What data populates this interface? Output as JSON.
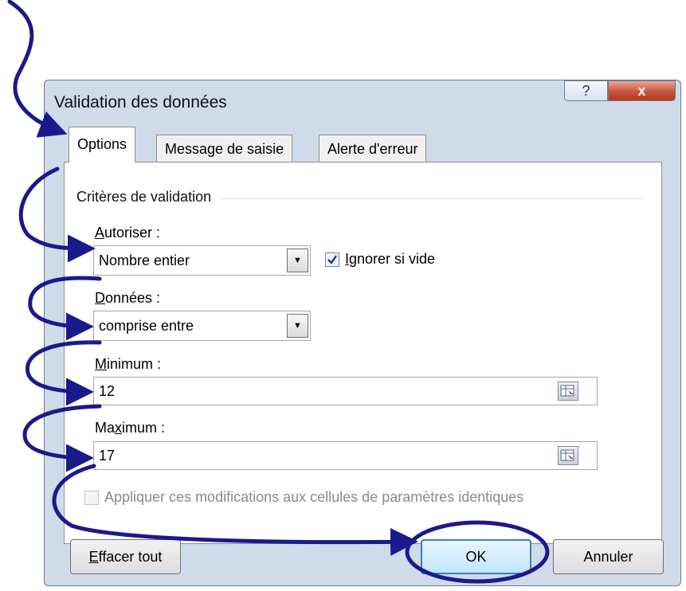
{
  "dialog": {
    "title": "Validation des données",
    "help_glyph": "?",
    "close_glyph": "x"
  },
  "tabs": [
    {
      "label": "Options",
      "active": true
    },
    {
      "label": "Message de saisie",
      "active": false
    },
    {
      "label": "Alerte d'erreur",
      "active": false
    }
  ],
  "criteria": {
    "group_label": "Critères de validation",
    "allow": {
      "label_u": "A",
      "label_rest": "utoriser :",
      "value": "Nombre entier"
    },
    "ignore_blank": {
      "label_u": "I",
      "label_rest": "gnorer si vide",
      "checked": true
    },
    "data": {
      "label_u": "D",
      "label_rest": "onnées :",
      "value": "comprise entre"
    },
    "minimum": {
      "label_u": "M",
      "label_rest": "inimum :",
      "value": "12"
    },
    "maximum": {
      "label_pre": "Ma",
      "label_u": "x",
      "label_rest": "imum :",
      "value": "17"
    },
    "apply_all": {
      "label": "Appliquer ces modifications aux cellules de paramètres identiques",
      "checked": false,
      "enabled": false
    }
  },
  "buttons": {
    "clear_u": "E",
    "clear_rest": "ffacer tout",
    "ok": "OK",
    "cancel": "Annuler"
  },
  "colors": {
    "annotation": "#1a1a8c",
    "chrome": "#cfdbe9",
    "close": "#c8553c"
  }
}
